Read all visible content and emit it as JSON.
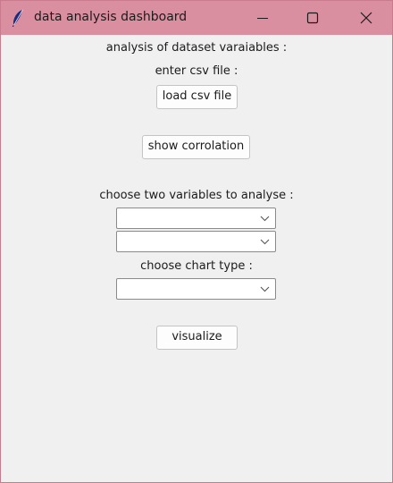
{
  "window": {
    "title": "data analysis dashboard"
  },
  "main": {
    "heading": "analysis of dataset varaiables :",
    "enter_csv_label": "enter csv file :",
    "load_csv_button": "load csv file",
    "show_correlation_button": "show corrolation",
    "choose_variables_label": "choose two variables to analyse :",
    "variable_1": {
      "value": ""
    },
    "variable_2": {
      "value": ""
    },
    "choose_chart_label": "choose chart type :",
    "chart_type": {
      "value": ""
    },
    "visualize_button": "visualize"
  },
  "icons": {
    "app": "feather-icon",
    "minimize": "minimize-icon",
    "maximize": "maximize-icon",
    "close": "close-icon",
    "dropdown": "chevron-down-icon"
  },
  "colors": {
    "titlebar": "#da8fa0",
    "window_background": "#f0f0f0",
    "button_background": "#fdfdfd"
  }
}
